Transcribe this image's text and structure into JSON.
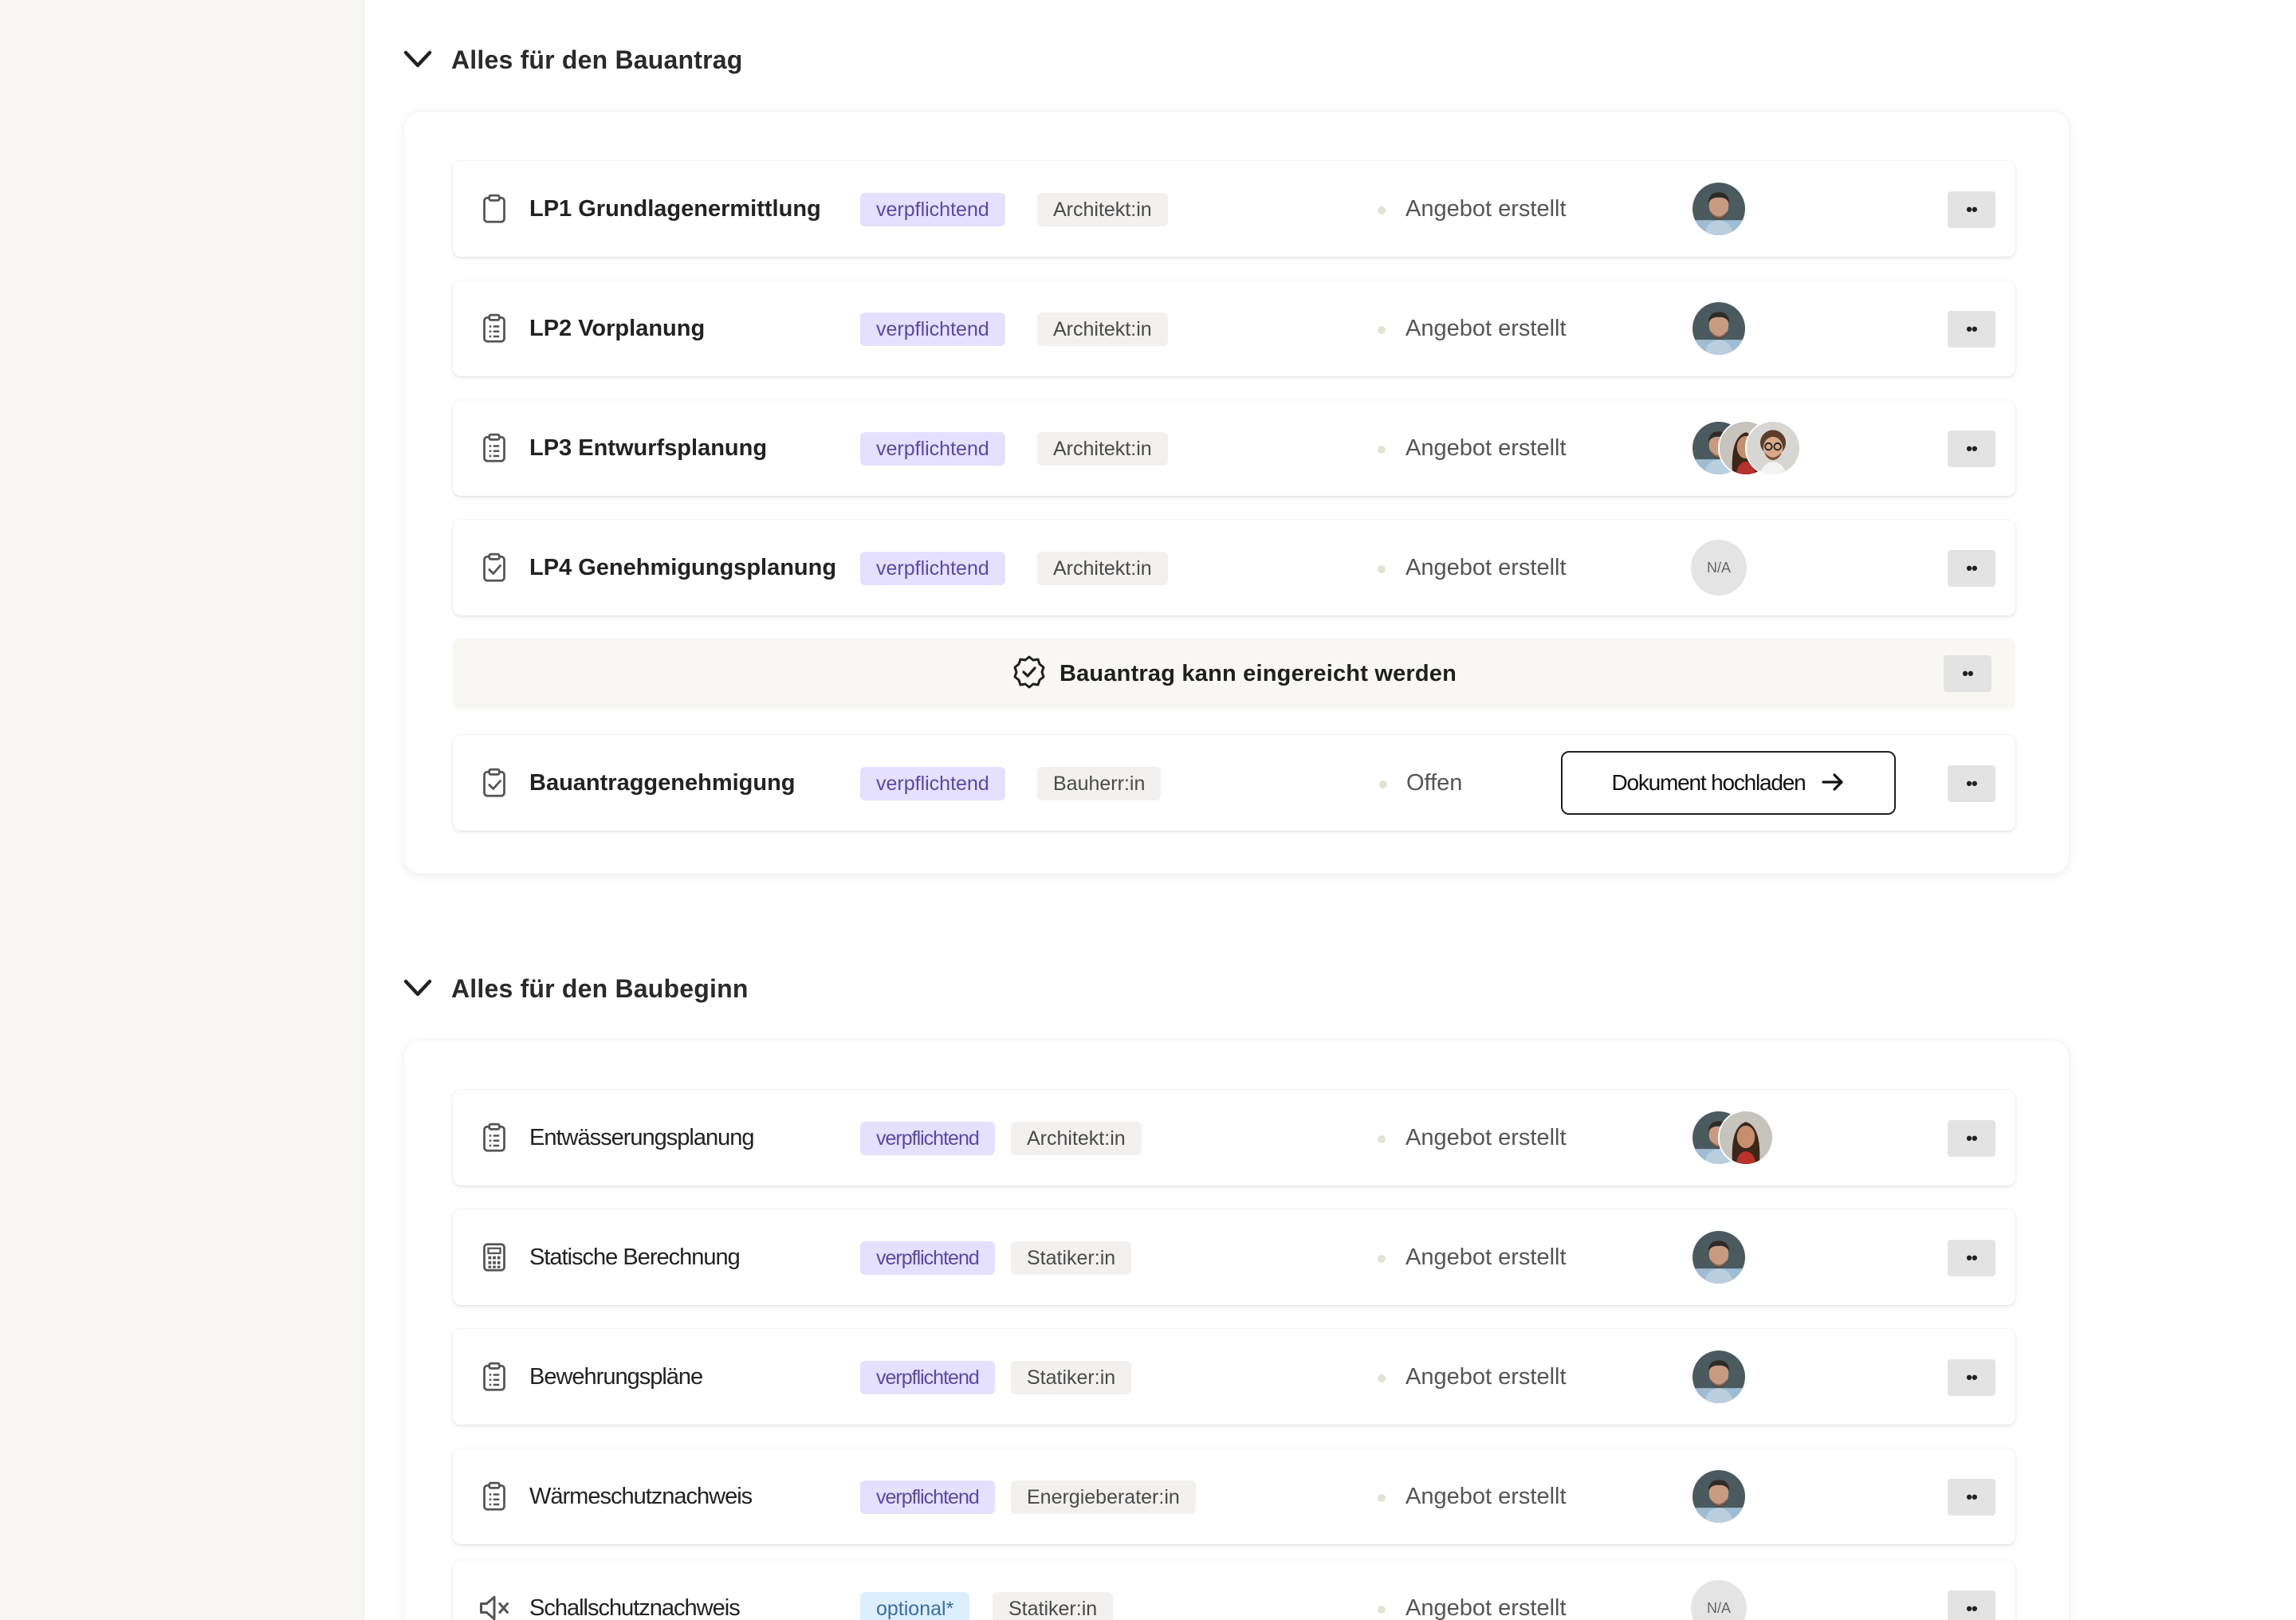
{
  "sections": [
    {
      "title": "Alles für den Bauantrag",
      "rows": [
        {
          "title": "LP1 Grundlagenermittlung",
          "tag": "verpflichtend",
          "role": "Architekt:in",
          "status": "Angebot erstellt",
          "avatars": [
            "person-a"
          ],
          "icon": "clipboard-icon"
        },
        {
          "title": "LP2 Vorplanung",
          "tag": "verpflichtend",
          "role": "Architekt:in",
          "status": "Angebot erstellt",
          "avatars": [
            "person-a"
          ],
          "icon": "clipboard-list-icon"
        },
        {
          "title": "LP3 Entwurfsplanung",
          "tag": "verpflichtend",
          "role": "Architekt:in",
          "status": "Angebot erstellt",
          "avatars": [
            "person-a",
            "person-b",
            "person-c"
          ],
          "icon": "clipboard-list-icon"
        },
        {
          "title": "LP4 Genehmigungsplanung",
          "tag": "verpflichtend",
          "role": "Architekt:in",
          "status": "Angebot erstellt",
          "avatar_placeholder": "N/A",
          "icon": "clipboard-check-icon"
        }
      ],
      "milestone": {
        "text": "Bauantrag kann eingereicht werden",
        "icon": "badge-check-icon"
      },
      "final_row": {
        "title": "Bauantraggenehmigung",
        "tag": "verpflichtend",
        "role": "Bauherr:in",
        "status": "Offen",
        "button": "Dokument hochladen",
        "icon": "clipboard-check-icon"
      }
    },
    {
      "title": "Alles für den Baubeginn",
      "rows": [
        {
          "title": "Entwässerungsplanung",
          "tag": "verpflichtend",
          "role": "Architekt:in",
          "status": "Angebot erstellt",
          "avatars": [
            "person-a",
            "person-b"
          ],
          "icon": "clipboard-list-icon"
        },
        {
          "title": "Statische Berechnung",
          "tag": "verpflichtend",
          "role": "Statiker:in",
          "status": "Angebot erstellt",
          "avatars": [
            "person-a"
          ],
          "icon": "calculator-icon"
        },
        {
          "title": "Bewehrungspläne",
          "tag": "verpflichtend",
          "role": "Statiker:in",
          "status": "Angebot erstellt",
          "avatars": [
            "person-a"
          ],
          "icon": "clipboard-list-icon"
        },
        {
          "title": "Wärmeschutznachweis",
          "tag": "verpflichtend",
          "role": "Energieberater:in",
          "status": "Angebot erstellt",
          "avatars": [
            "person-a"
          ],
          "icon": "clipboard-list-icon"
        },
        {
          "title": "Schallschutznachweis",
          "tag": "optional*",
          "role": "Statiker:in",
          "status": "Angebot erstellt",
          "avatar_placeholder": "N/A",
          "icon": "speaker-mute-icon"
        }
      ]
    }
  ],
  "more_label": "••",
  "colors": {
    "tag_required_bg": "#e6e0ff",
    "tag_optional_bg": "#dcefff",
    "role_bg": "#f2f1ef",
    "status_dot": "#e2e4d2",
    "sidebar_bg": "#f8f7f4"
  }
}
